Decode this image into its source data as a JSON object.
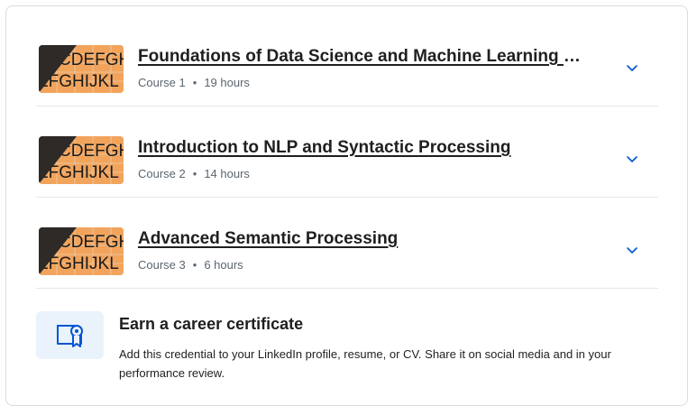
{
  "courses": [
    {
      "title": "Foundations of Data Science and Machine Learning with Python",
      "course_label": "Course 1",
      "duration": "19 hours"
    },
    {
      "title": "Introduction to NLP and Syntactic Processing",
      "course_label": "Course 2",
      "duration": "14 hours"
    },
    {
      "title": "Advanced Semantic Processing",
      "course_label": "Course 3",
      "duration": "6 hours"
    }
  ],
  "meta_separator": "•",
  "thumbnail": {
    "line1": "CDEFGH",
    "line2": "EFGHIJKL",
    "colors": {
      "bg": "#f2a45c",
      "dark": "#2d2a28",
      "text": "#1a1a1a"
    }
  },
  "certificate": {
    "title": "Earn a career certificate",
    "description": "Add this credential to your LinkedIn profile, resume, or CV. Share it on social media and in your performance review.",
    "icon": "certificate-icon"
  },
  "colors": {
    "accent": "#0056d2",
    "border": "#dadce0",
    "divider": "#e5e7e9",
    "cert_bg": "#eaf2fb"
  }
}
